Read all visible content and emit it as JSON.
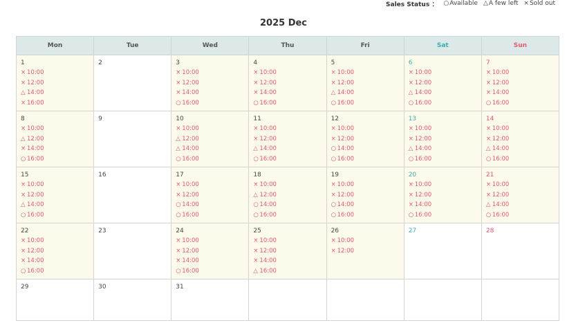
{
  "legend": {
    "title": "Sales Status",
    "separator": "：",
    "items": [
      {
        "symbol": "○",
        "label": "Available"
      },
      {
        "symbol": "△",
        "label": "A few left"
      },
      {
        "symbol": "×",
        "label": "Sold out"
      }
    ]
  },
  "calendar": {
    "title": "2025 Dec",
    "weekdays": [
      "Mon",
      "Tue",
      "Wed",
      "Thu",
      "Fri",
      "Sat",
      "Sun"
    ],
    "colors": {
      "saturday": "#3aaeb0",
      "sunday": "#e8566f",
      "slot": "#e8566f",
      "slot_day_bg": "#fcfaea",
      "header_bg": "#dde8e8"
    },
    "weeks": [
      [
        {
          "day": "1",
          "slots": [
            {
              "status": "×",
              "time": "10:00"
            },
            {
              "status": "×",
              "time": "12:00"
            },
            {
              "status": "△",
              "time": "14:00"
            },
            {
              "status": "×",
              "time": "16:00"
            }
          ]
        },
        {
          "day": "2",
          "slots": []
        },
        {
          "day": "3",
          "slots": [
            {
              "status": "×",
              "time": "10:00"
            },
            {
              "status": "×",
              "time": "12:00"
            },
            {
              "status": "×",
              "time": "14:00"
            },
            {
              "status": "○",
              "time": "16:00"
            }
          ]
        },
        {
          "day": "4",
          "slots": [
            {
              "status": "×",
              "time": "10:00"
            },
            {
              "status": "×",
              "time": "12:00"
            },
            {
              "status": "×",
              "time": "14:00"
            },
            {
              "status": "○",
              "time": "16:00"
            }
          ]
        },
        {
          "day": "5",
          "slots": [
            {
              "status": "×",
              "time": "10:00"
            },
            {
              "status": "×",
              "time": "12:00"
            },
            {
              "status": "△",
              "time": "14:00"
            },
            {
              "status": "○",
              "time": "16:00"
            }
          ]
        },
        {
          "day": "6",
          "slots": [
            {
              "status": "×",
              "time": "10:00"
            },
            {
              "status": "×",
              "time": "12:00"
            },
            {
              "status": "△",
              "time": "14:00"
            },
            {
              "status": "○",
              "time": "16:00"
            }
          ]
        },
        {
          "day": "7",
          "slots": [
            {
              "status": "×",
              "time": "10:00"
            },
            {
              "status": "×",
              "time": "12:00"
            },
            {
              "status": "×",
              "time": "14:00"
            },
            {
              "status": "○",
              "time": "16:00"
            }
          ]
        }
      ],
      [
        {
          "day": "8",
          "slots": [
            {
              "status": "×",
              "time": "10:00"
            },
            {
              "status": "△",
              "time": "12:00"
            },
            {
              "status": "×",
              "time": "14:00"
            },
            {
              "status": "○",
              "time": "16:00"
            }
          ]
        },
        {
          "day": "9",
          "slots": []
        },
        {
          "day": "10",
          "slots": [
            {
              "status": "×",
              "time": "10:00"
            },
            {
              "status": "△",
              "time": "12:00"
            },
            {
              "status": "△",
              "time": "14:00"
            },
            {
              "status": "○",
              "time": "16:00"
            }
          ]
        },
        {
          "day": "11",
          "slots": [
            {
              "status": "×",
              "time": "10:00"
            },
            {
              "status": "×",
              "time": "12:00"
            },
            {
              "status": "△",
              "time": "14:00"
            },
            {
              "status": "○",
              "time": "16:00"
            }
          ]
        },
        {
          "day": "12",
          "slots": [
            {
              "status": "×",
              "time": "10:00"
            },
            {
              "status": "×",
              "time": "12:00"
            },
            {
              "status": "○",
              "time": "14:00"
            },
            {
              "status": "○",
              "time": "16:00"
            }
          ]
        },
        {
          "day": "13",
          "slots": [
            {
              "status": "×",
              "time": "10:00"
            },
            {
              "status": "×",
              "time": "12:00"
            },
            {
              "status": "△",
              "time": "14:00"
            },
            {
              "status": "○",
              "time": "16:00"
            }
          ]
        },
        {
          "day": "14",
          "slots": [
            {
              "status": "×",
              "time": "10:00"
            },
            {
              "status": "×",
              "time": "12:00"
            },
            {
              "status": "△",
              "time": "14:00"
            },
            {
              "status": "○",
              "time": "16:00"
            }
          ]
        }
      ],
      [
        {
          "day": "15",
          "slots": [
            {
              "status": "×",
              "time": "10:00"
            },
            {
              "status": "×",
              "time": "12:00"
            },
            {
              "status": "△",
              "time": "14:00"
            },
            {
              "status": "○",
              "time": "16:00"
            }
          ]
        },
        {
          "day": "16",
          "slots": []
        },
        {
          "day": "17",
          "slots": [
            {
              "status": "×",
              "time": "10:00"
            },
            {
              "status": "×",
              "time": "12:00"
            },
            {
              "status": "○",
              "time": "14:00"
            },
            {
              "status": "○",
              "time": "16:00"
            }
          ]
        },
        {
          "day": "18",
          "slots": [
            {
              "status": "×",
              "time": "10:00"
            },
            {
              "status": "△",
              "time": "12:00"
            },
            {
              "status": "○",
              "time": "14:00"
            },
            {
              "status": "○",
              "time": "16:00"
            }
          ]
        },
        {
          "day": "19",
          "slots": [
            {
              "status": "×",
              "time": "10:00"
            },
            {
              "status": "×",
              "time": "12:00"
            },
            {
              "status": "○",
              "time": "14:00"
            },
            {
              "status": "○",
              "time": "16:00"
            }
          ]
        },
        {
          "day": "20",
          "slots": [
            {
              "status": "×",
              "time": "10:00"
            },
            {
              "status": "×",
              "time": "12:00"
            },
            {
              "status": "×",
              "time": "14:00"
            },
            {
              "status": "○",
              "time": "16:00"
            }
          ]
        },
        {
          "day": "21",
          "slots": [
            {
              "status": "×",
              "time": "10:00"
            },
            {
              "status": "×",
              "time": "12:00"
            },
            {
              "status": "△",
              "time": "14:00"
            },
            {
              "status": "○",
              "time": "16:00"
            }
          ]
        }
      ],
      [
        {
          "day": "22",
          "slots": [
            {
              "status": "×",
              "time": "10:00"
            },
            {
              "status": "×",
              "time": "12:00"
            },
            {
              "status": "×",
              "time": "14:00"
            },
            {
              "status": "○",
              "time": "16:00"
            }
          ]
        },
        {
          "day": "23",
          "slots": []
        },
        {
          "day": "24",
          "slots": [
            {
              "status": "×",
              "time": "10:00"
            },
            {
              "status": "×",
              "time": "12:00"
            },
            {
              "status": "×",
              "time": "14:00"
            },
            {
              "status": "○",
              "time": "16:00"
            }
          ]
        },
        {
          "day": "25",
          "slots": [
            {
              "status": "×",
              "time": "10:00"
            },
            {
              "status": "×",
              "time": "12:00"
            },
            {
              "status": "×",
              "time": "14:00"
            },
            {
              "status": "△",
              "time": "16:00"
            }
          ]
        },
        {
          "day": "26",
          "slots": [
            {
              "status": "×",
              "time": "10:00"
            },
            {
              "status": "×",
              "time": "12:00"
            }
          ]
        },
        {
          "day": "27",
          "slots": []
        },
        {
          "day": "28",
          "slots": []
        }
      ],
      [
        {
          "day": "29",
          "slots": []
        },
        {
          "day": "30",
          "slots": []
        },
        {
          "day": "31",
          "slots": []
        },
        {
          "day": "",
          "slots": []
        },
        {
          "day": "",
          "slots": []
        },
        {
          "day": "",
          "slots": []
        },
        {
          "day": "",
          "slots": []
        }
      ]
    ]
  }
}
